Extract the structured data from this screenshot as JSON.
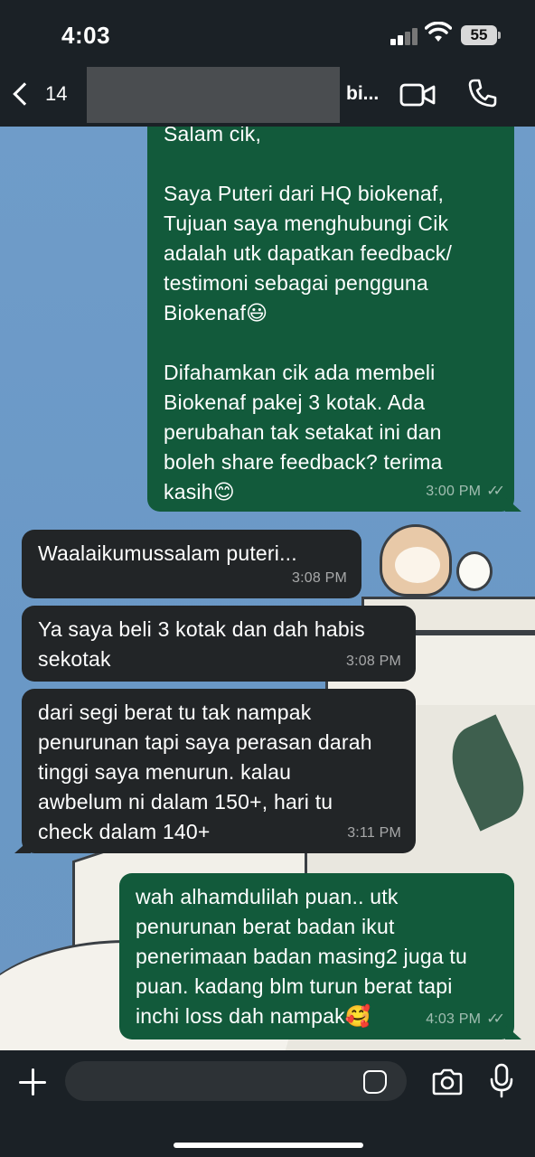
{
  "status_bar": {
    "time": "4:03",
    "battery": "55"
  },
  "header": {
    "back_count": "14",
    "contact_name_visible": "bi...",
    "icons": {
      "back": "chevron-left-icon",
      "video": "video-camera-icon",
      "call": "phone-icon"
    }
  },
  "messages": [
    {
      "direction": "out",
      "text": "Salam cik,\n\nSaya Puteri dari HQ biokenaf,\nTujuan saya menghubungi Cik\nadalah utk dapatkan feedback/\ntestimoni sebagai pengguna\nBiokenaf😃\n\nDifahamkan cik ada membeli\nBiokenaf pakej 3 kotak. Ada\nperubahan tak setakat ini dan\nboleh share feedback? terima\nkasih😊",
      "time": "3:00 PM",
      "ticks": "✓✓"
    },
    {
      "direction": "in",
      "text": "Waalaikumussalam puteri...",
      "time": "3:08 PM"
    },
    {
      "direction": "in",
      "text": "Ya saya beli 3 kotak dan dah habis\nsekotak",
      "time": "3:08 PM"
    },
    {
      "direction": "in",
      "text": "dari segi berat tu tak nampak\npenurunan tapi saya perasan darah\ntinggi saya menurun. kalau\nawbelum ni dalam 150+, hari tu\ncheck dalam 140+",
      "time": "3:11 PM"
    },
    {
      "direction": "out",
      "text": "wah alhamdulilah puan.. utk\npenurunan berat badan ikut\npenerimaan badan masing2 juga tu\npuan. kadang blm turun berat tapi\ninchi loss dah nampak🥰",
      "time": "4:03 PM",
      "ticks": "✓✓"
    }
  ],
  "composer": {
    "placeholder": "",
    "icons": {
      "plus": "plus-icon",
      "sticker": "sticker-icon",
      "camera": "camera-icon",
      "mic": "microphone-icon"
    }
  },
  "colors": {
    "outgoing_bubble": "#125a3b",
    "incoming_bubble": "#222527",
    "bar": "#1b2126"
  }
}
